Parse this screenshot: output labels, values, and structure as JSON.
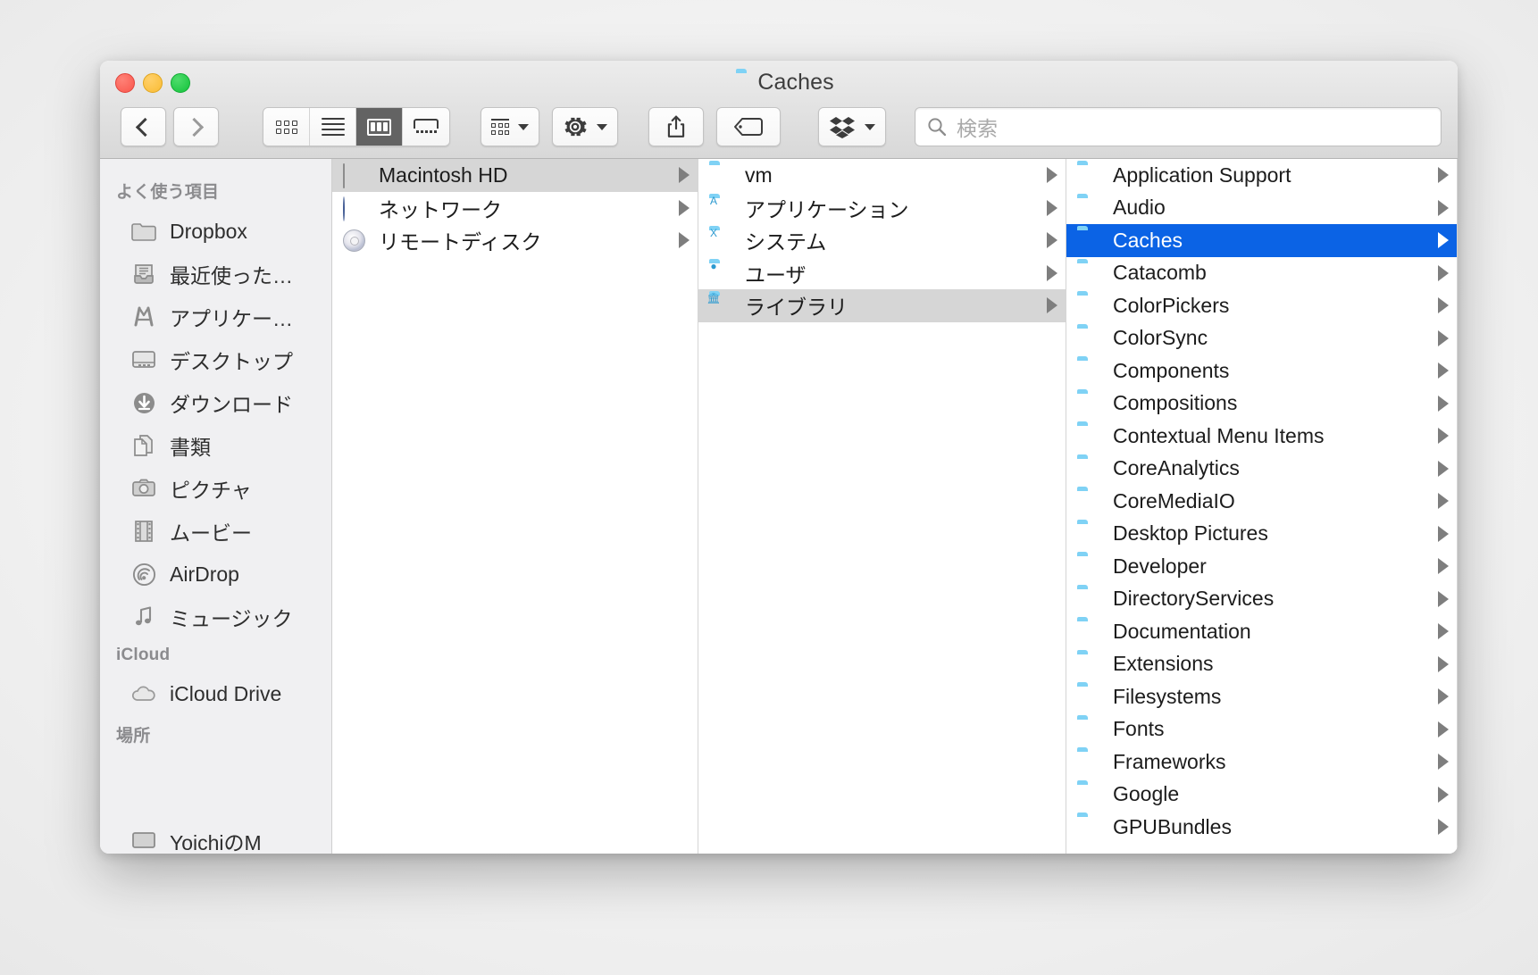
{
  "window": {
    "title": "Caches",
    "title_icon": "folder-icon",
    "traffic_lights": [
      {
        "name": "close",
        "color": "#f9564c"
      },
      {
        "name": "minimize",
        "color": "#f9bc34"
      },
      {
        "name": "zoom",
        "color": "#13c23b"
      }
    ]
  },
  "toolbar": {
    "back_label": "戻る",
    "forward_label": "進む",
    "view_modes": [
      {
        "id": "icon-view",
        "active": false
      },
      {
        "id": "list-view",
        "active": false
      },
      {
        "id": "column-view",
        "active": true
      },
      {
        "id": "gallery-view",
        "active": false
      }
    ],
    "arrange_label": "整理",
    "action_label": "操作",
    "share_label": "共有",
    "tag_label": "タグ",
    "dropbox_label": "Dropbox",
    "search": {
      "placeholder": "検索",
      "value": ""
    }
  },
  "sidebar": {
    "sections": [
      {
        "header": "よく使う項目",
        "items": [
          {
            "label": "Dropbox",
            "icon": "folder-icon"
          },
          {
            "label": "最近使った…",
            "icon": "recents-icon"
          },
          {
            "label": "アプリケー…",
            "icon": "applications-icon"
          },
          {
            "label": "デスクトップ",
            "icon": "desktop-icon"
          },
          {
            "label": "ダウンロード",
            "icon": "downloads-icon"
          },
          {
            "label": "書類",
            "icon": "documents-icon"
          },
          {
            "label": "ピクチャ",
            "icon": "pictures-icon"
          },
          {
            "label": "ムービー",
            "icon": "movies-icon"
          },
          {
            "label": "AirDrop",
            "icon": "airdrop-icon"
          },
          {
            "label": "ミュージック",
            "icon": "music-icon"
          }
        ]
      },
      {
        "header": "iCloud",
        "items": [
          {
            "label": "iCloud Drive",
            "icon": "cloud-icon"
          }
        ]
      },
      {
        "header": "場所",
        "items": [
          {
            "label": "YoichiのM",
            "icon": "computer-icon"
          }
        ]
      }
    ]
  },
  "columns": [
    {
      "id": "column-devices",
      "rows": [
        {
          "label": "Macintosh HD",
          "icon": "harddisk-icon",
          "selection": "gray",
          "disclosure": true
        },
        {
          "label": "ネットワーク",
          "icon": "network-icon",
          "selection": "none",
          "disclosure": true
        },
        {
          "label": "リモートディスク",
          "icon": "disc-icon",
          "selection": "none",
          "disclosure": true
        }
      ]
    },
    {
      "id": "column-macintosh-hd",
      "rows": [
        {
          "label": "vm",
          "icon": "folder-icon",
          "selection": "none",
          "disclosure": true
        },
        {
          "label": "アプリケーション",
          "icon": "folder-applications-icon",
          "selection": "none",
          "disclosure": true
        },
        {
          "label": "システム",
          "icon": "folder-system-icon",
          "selection": "none",
          "disclosure": true
        },
        {
          "label": "ユーザ",
          "icon": "folder-users-icon",
          "selection": "none",
          "disclosure": true
        },
        {
          "label": "ライブラリ",
          "icon": "folder-library-icon",
          "selection": "gray",
          "disclosure": true
        }
      ]
    },
    {
      "id": "column-library",
      "rows": [
        {
          "label": "Application Support",
          "icon": "folder-icon",
          "selection": "none",
          "disclosure": true
        },
        {
          "label": "Audio",
          "icon": "folder-icon",
          "selection": "none",
          "disclosure": true
        },
        {
          "label": "Caches",
          "icon": "folder-icon",
          "selection": "blue",
          "disclosure": true
        },
        {
          "label": "Catacomb",
          "icon": "folder-icon",
          "selection": "none",
          "disclosure": true
        },
        {
          "label": "ColorPickers",
          "icon": "folder-icon",
          "selection": "none",
          "disclosure": true
        },
        {
          "label": "ColorSync",
          "icon": "folder-icon",
          "selection": "none",
          "disclosure": true
        },
        {
          "label": "Components",
          "icon": "folder-icon",
          "selection": "none",
          "disclosure": true
        },
        {
          "label": "Compositions",
          "icon": "folder-icon",
          "selection": "none",
          "disclosure": true
        },
        {
          "label": "Contextual Menu Items",
          "icon": "folder-icon",
          "selection": "none",
          "disclosure": true
        },
        {
          "label": "CoreAnalytics",
          "icon": "folder-icon",
          "selection": "none",
          "disclosure": true
        },
        {
          "label": "CoreMediaIO",
          "icon": "folder-icon",
          "selection": "none",
          "disclosure": true
        },
        {
          "label": "Desktop Pictures",
          "icon": "folder-icon",
          "selection": "none",
          "disclosure": true
        },
        {
          "label": "Developer",
          "icon": "folder-icon",
          "selection": "none",
          "disclosure": true
        },
        {
          "label": "DirectoryServices",
          "icon": "folder-icon",
          "selection": "none",
          "disclosure": true
        },
        {
          "label": "Documentation",
          "icon": "folder-icon",
          "selection": "none",
          "disclosure": true
        },
        {
          "label": "Extensions",
          "icon": "folder-icon",
          "selection": "none",
          "disclosure": true
        },
        {
          "label": "Filesystems",
          "icon": "folder-icon",
          "selection": "none",
          "disclosure": true
        },
        {
          "label": "Fonts",
          "icon": "folder-icon",
          "selection": "none",
          "disclosure": true
        },
        {
          "label": "Frameworks",
          "icon": "folder-icon",
          "selection": "none",
          "disclosure": true
        },
        {
          "label": "Google",
          "icon": "folder-icon",
          "selection": "none",
          "disclosure": true
        },
        {
          "label": "GPUBundles",
          "icon": "folder-icon",
          "selection": "none",
          "disclosure": true
        }
      ]
    }
  ],
  "colors": {
    "selection_blue": "#0b63e5",
    "selection_gray": "#d6d6d6",
    "folder_blue": "#5cc3ee",
    "sidebar_bg": "#f0f0f2"
  }
}
